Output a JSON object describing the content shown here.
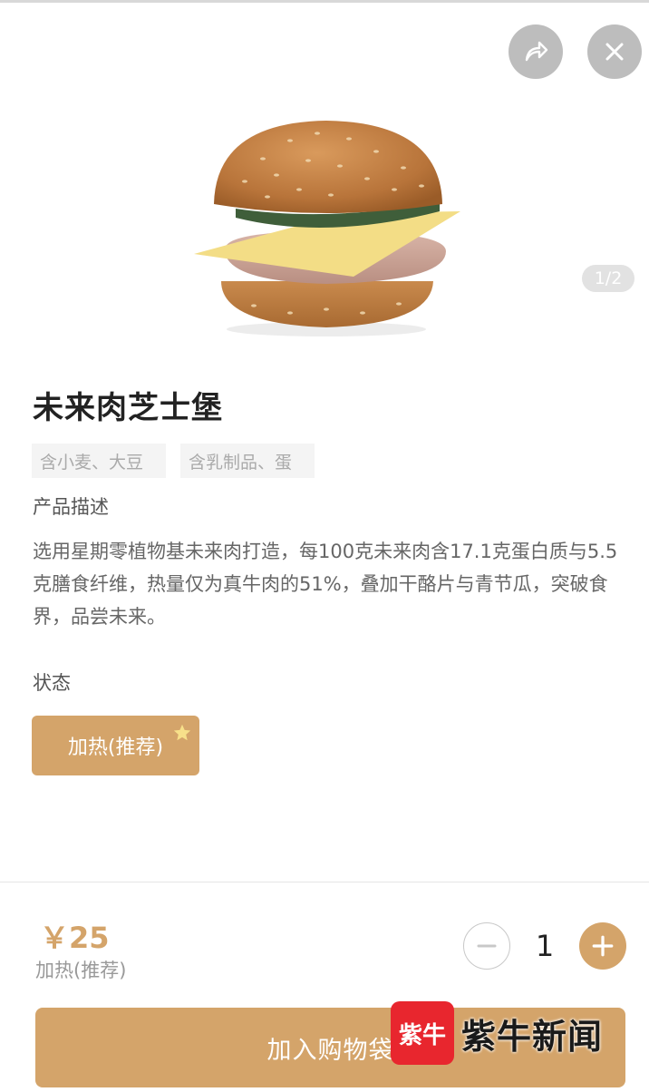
{
  "header": {
    "share_icon": "share-icon",
    "close_icon": "close-icon"
  },
  "gallery": {
    "counter": "1/2"
  },
  "product": {
    "title": "未来肉芝士堡",
    "tags": [
      "含小麦、大豆",
      "含乳制品、蛋"
    ],
    "desc_title": "产品描述",
    "description": "选用星期零植物基未来肉打造，每100克未来肉含17.1克蛋白质与5.5克膳食纤维，热量仅为真牛肉的51%，叠加干酪片与青节瓜，突破食界，品尝未来。",
    "status_title": "状态",
    "option_label": "加热(推荐)"
  },
  "footer": {
    "price": "￥25",
    "variant": "加热(推荐)",
    "quantity": "1",
    "cart_label": "加入购物袋"
  },
  "watermark": {
    "badge": "紫牛",
    "text": "紫牛新闻"
  },
  "colors": {
    "accent": "#d4a46a",
    "watermark_red": "#e8262e"
  }
}
